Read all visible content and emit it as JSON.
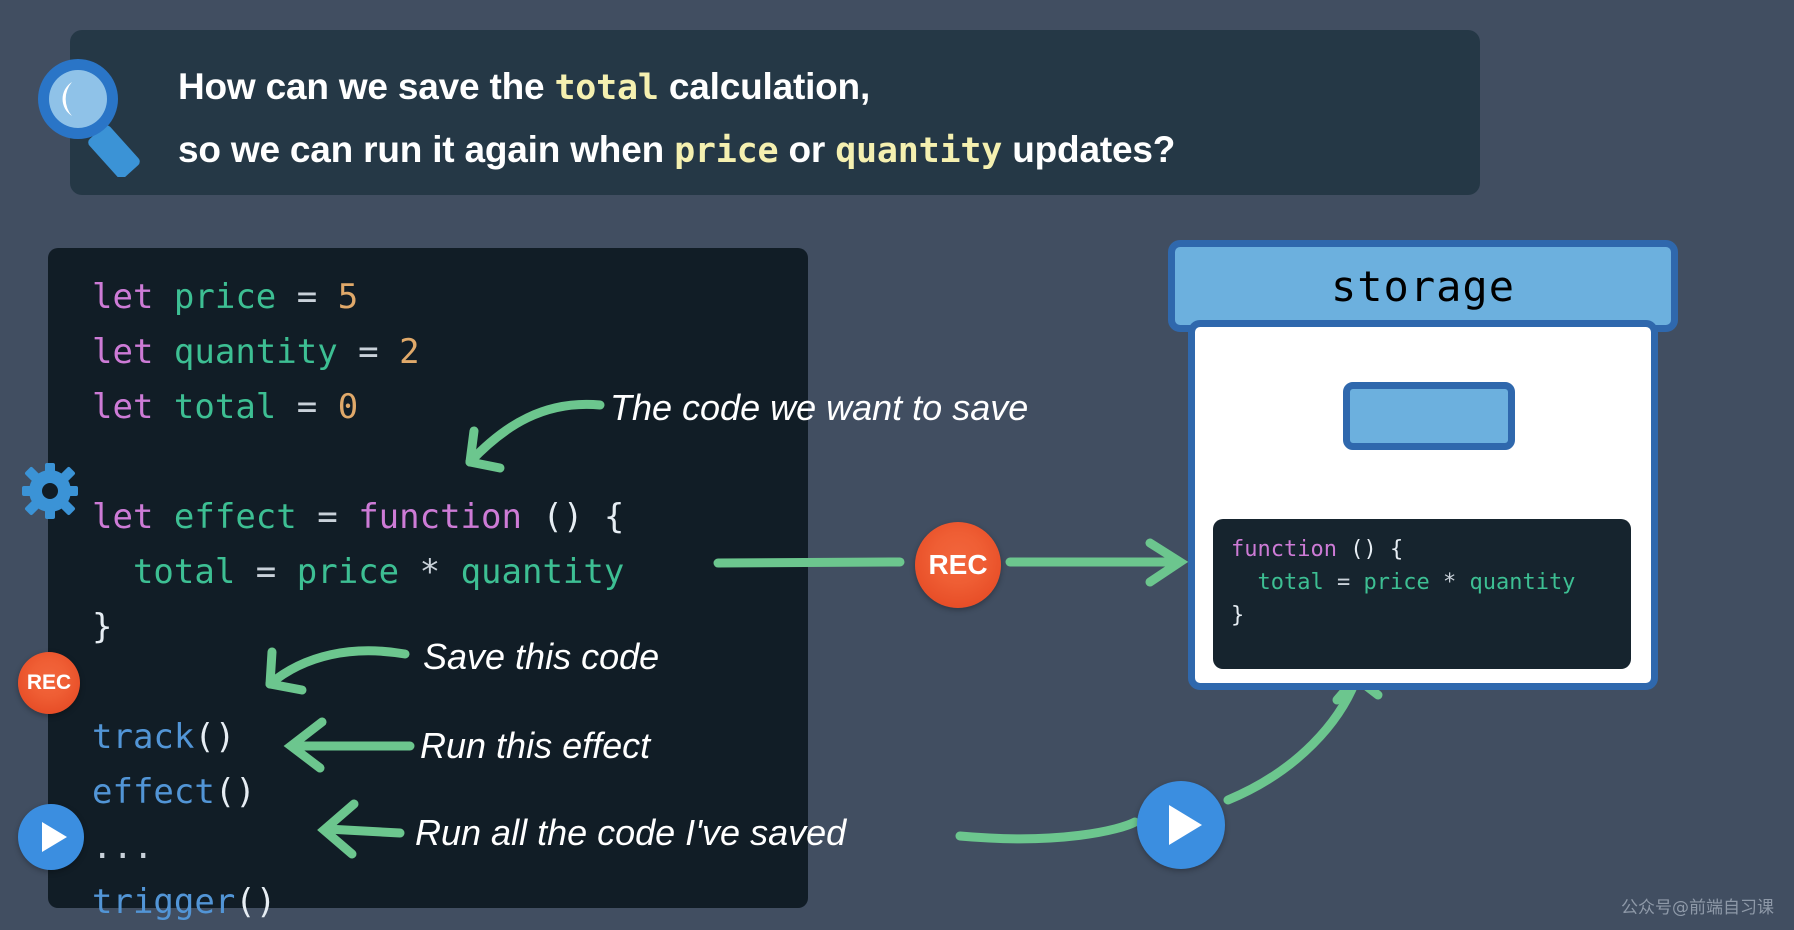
{
  "question": {
    "icon": "magnifier-icon",
    "line1_parts": [
      {
        "text": "How can we save the ",
        "style": "plain"
      },
      {
        "text": "total",
        "style": "code"
      },
      {
        "text": " calculation,",
        "style": "plain"
      }
    ],
    "line2_parts": [
      {
        "text": "so we can run it again when ",
        "style": "plain"
      },
      {
        "text": "price",
        "style": "code"
      },
      {
        "text": " or ",
        "style": "plain"
      },
      {
        "text": "quantity",
        "style": "code"
      },
      {
        "text": " updates?",
        "style": "plain"
      }
    ],
    "line1_plain": "How can we save the total calculation,",
    "line2_plain": "so we can run it again when price or quantity updates?"
  },
  "code_panel": {
    "lines": [
      "let price = 5",
      "let quantity = 2",
      "let total = 0",
      "",
      "let effect = function () {",
      "  total = price * quantity",
      "}",
      "",
      "track()",
      "effect()",
      "...",
      "trigger()"
    ],
    "tokens": {
      "kw_let": "let",
      "kw_function": "function",
      "var_price": "price",
      "var_quantity": "quantity",
      "var_total": "total",
      "num_5": "5",
      "num_2": "2",
      "num_0": "0",
      "op_eq": "=",
      "op_mul": "*",
      "paren_empty": "()",
      "brace_open": "{",
      "brace_close": "}",
      "fn_track": "track",
      "fn_effect": "effect",
      "fn_trigger": "trigger",
      "ellipsis": "..."
    }
  },
  "annotations": {
    "save_code": "The code we want to save",
    "save_this": "Save this code",
    "run_effect": "Run this effect",
    "run_all": "Run all the code I've saved"
  },
  "badges": {
    "rec_label": "REC",
    "play_icon": "play-triangle-icon",
    "gear_icon": "gear-icon"
  },
  "storage": {
    "title": "storage",
    "saved_code_lines": [
      "function () {",
      "  total = price * quantity",
      "}"
    ],
    "saved_tokens": {
      "kw_function": "function",
      "paren_empty": "()",
      "brace_open": "{",
      "brace_close": "}",
      "var_total": "total",
      "var_price": "price",
      "var_quantity": "quantity",
      "op_eq": "=",
      "op_mul": "*"
    }
  },
  "watermark": "公众号@前端自习课",
  "colors": {
    "background": "#414e61",
    "banner_bg": "#253846",
    "code_bg": "#111d26",
    "code_keyword": "#cd7bd6",
    "code_variable": "#3dbf93",
    "code_number": "#e0a96a",
    "code_function": "#5295d6",
    "code_punct": "#e6edf3",
    "highlight_yellow": "#f5f0b0",
    "rec_red": "#ef5e34",
    "play_blue": "#3b8ee0",
    "storage_light_blue": "#6cb0de",
    "storage_border_blue": "#2f68ad",
    "arrow_green": "#6cc68e"
  }
}
